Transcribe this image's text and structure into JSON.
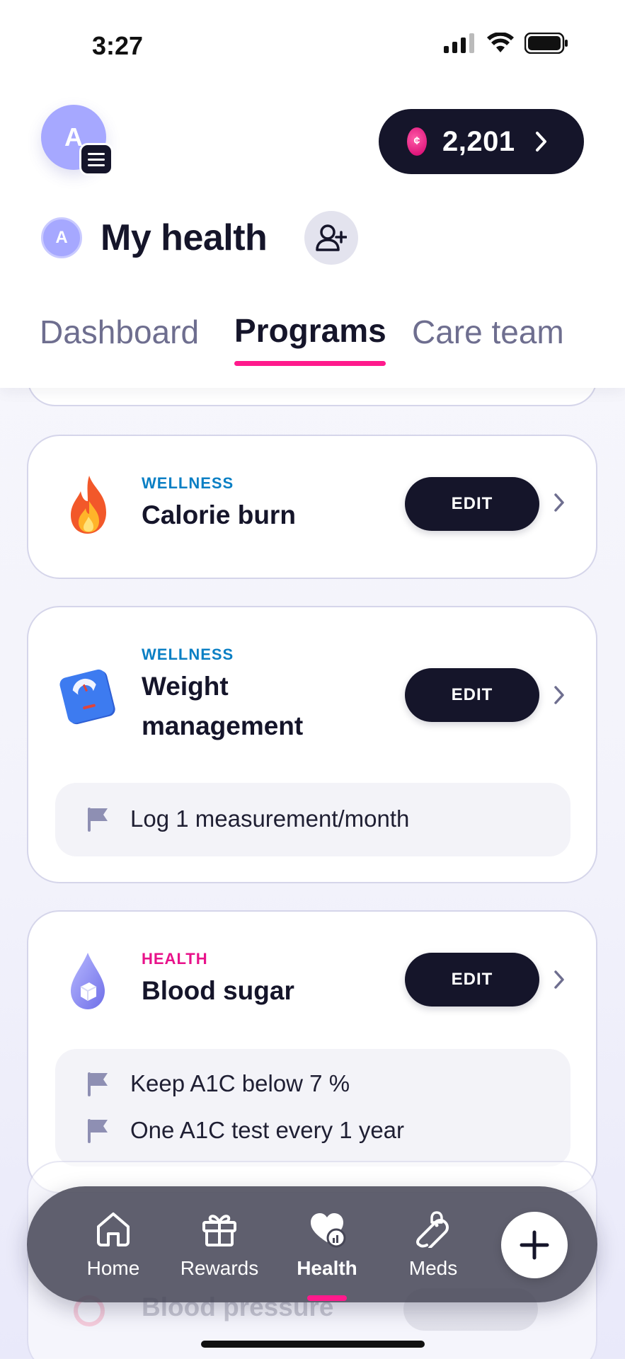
{
  "status_bar": {
    "time": "3:27"
  },
  "header": {
    "avatar_initial": "A",
    "points": "2,201",
    "profile_initial": "A",
    "title": "My health"
  },
  "tabs": [
    {
      "label": "Dashboard",
      "active": false
    },
    {
      "label": "Programs",
      "active": true
    },
    {
      "label": "Care team",
      "active": false
    }
  ],
  "programs": [
    {
      "category": "WELLNESS",
      "title": "Calorie burn",
      "icon": "fire-icon",
      "edit_label": "EDIT",
      "goals": []
    },
    {
      "category": "WELLNESS",
      "title_line1": "Weight",
      "title_line2": "management",
      "icon": "scale-icon",
      "edit_label": "EDIT",
      "goals": [
        "Log 1 measurement/month"
      ]
    },
    {
      "category": "HEALTH",
      "title": "Blood sugar",
      "icon": "sugar-drop-icon",
      "edit_label": "EDIT",
      "goals": [
        "Keep A1C below 7 %",
        "One A1C test every 1 year"
      ]
    },
    {
      "title": "Blood pressure",
      "icon": "blood-pressure-icon"
    }
  ],
  "bottom_nav": [
    {
      "label": "Home",
      "icon": "home-icon",
      "active": false
    },
    {
      "label": "Rewards",
      "icon": "gift-icon",
      "active": false
    },
    {
      "label": "Health",
      "icon": "heart-chart-icon",
      "active": true
    },
    {
      "label": "Meds",
      "icon": "pill-bell-icon",
      "active": false
    }
  ],
  "colors": {
    "accent": "#ff1a8c",
    "dark": "#15152a",
    "wellness": "#0a7fc4",
    "health": "#e8128a",
    "avatar": "#a6a8ff"
  }
}
